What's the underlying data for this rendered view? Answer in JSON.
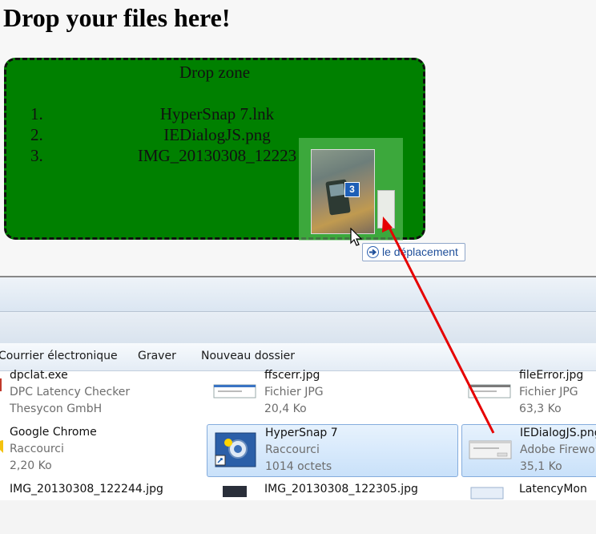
{
  "page": {
    "title": "Drop your files here!",
    "drop_zone": {
      "label": "Drop zone",
      "files": [
        {
          "num": "1.",
          "name": "HyperSnap 7.lnk"
        },
        {
          "num": "2.",
          "name": "IEDialogJS.png"
        },
        {
          "num": "3.",
          "name": "IMG_20130308_12223"
        }
      ]
    },
    "drag": {
      "count": "3",
      "tooltip": "le déplacement"
    }
  },
  "explorer": {
    "toolbar": [
      {
        "label": "Courrier électronique"
      },
      {
        "label": "Graver"
      },
      {
        "label": "Nouveau dossier"
      }
    ],
    "files": [
      {
        "name": "dpclat.exe",
        "line2": "DPC Latency Checker",
        "line3": "Thesycon GmbH",
        "icon": "exe-icon"
      },
      {
        "name": "ffscerr.jpg",
        "line2": "Fichier JPG",
        "line3": "20,4 Ko",
        "icon": "jpg-thumbnail"
      },
      {
        "name": "fileError.jpg",
        "line2": "Fichier JPG",
        "line3": "63,3 Ko",
        "icon": "jpg-thumbnail"
      },
      {
        "name": "Google Chrome",
        "line2": "Raccourci",
        "line3": "2,20 Ko",
        "icon": "chrome-icon"
      },
      {
        "name": "HyperSnap 7",
        "line2": "Raccourci",
        "line3": "1014 octets",
        "icon": "hypersnap-icon"
      },
      {
        "name": "IEDialogJS.png",
        "line2": "Adobe Firewor",
        "line3": "35,1 Ko",
        "icon": "png-thumbnail"
      },
      {
        "name": "IMG_20130308_122244.jpg",
        "line2": "",
        "line3": "",
        "icon": "photo-thumbnail"
      },
      {
        "name": "IMG_20130308_122305.jpg",
        "line2": "",
        "line3": "",
        "icon": "photo-thumbnail"
      },
      {
        "name": "LatencyMon",
        "line2": "",
        "line3": "",
        "icon": "app-icon"
      }
    ]
  },
  "colors": {
    "drop_zone": "#008000",
    "selection": "#c9e1fa",
    "arrow": "#e60000"
  }
}
